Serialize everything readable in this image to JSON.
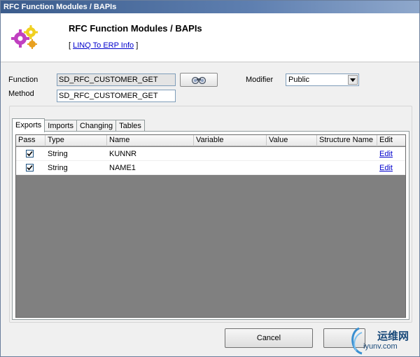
{
  "window": {
    "title": "RFC Function Modules / BAPIs"
  },
  "header": {
    "title": "RFC Function Modules / BAPIs",
    "link_open": "[",
    "link_text": "LINQ To ERP Info",
    "link_close": "]"
  },
  "form": {
    "function_label": "Function",
    "function_value": "SD_RFC_CUSTOMER_GET",
    "method_label": "Method",
    "method_value": "SD_RFC_CUSTOMER_GET",
    "modifier_label": "Modifier",
    "modifier_value": "Public"
  },
  "tabs": [
    "Exports",
    "Imports",
    "Changing",
    "Tables"
  ],
  "grid": {
    "columns": [
      "Pass",
      "Type",
      "Name",
      "Variable",
      "Value",
      "Structure Name",
      "Edit"
    ],
    "rows": [
      {
        "pass": true,
        "type": "String",
        "name": "KUNNR",
        "variable": "",
        "value": "",
        "structure": "",
        "edit": "Edit"
      },
      {
        "pass": true,
        "type": "String",
        "name": "NAME1",
        "variable": "",
        "value": "",
        "structure": "",
        "edit": "Edit"
      }
    ]
  },
  "buttons": {
    "cancel": "Cancel"
  },
  "watermark": {
    "text1": "运维网",
    "text2": "iyunv.com"
  },
  "colors": {
    "link": "#0000cc",
    "grid_bg": "#808080",
    "titlebar": "#3b5c8c"
  }
}
